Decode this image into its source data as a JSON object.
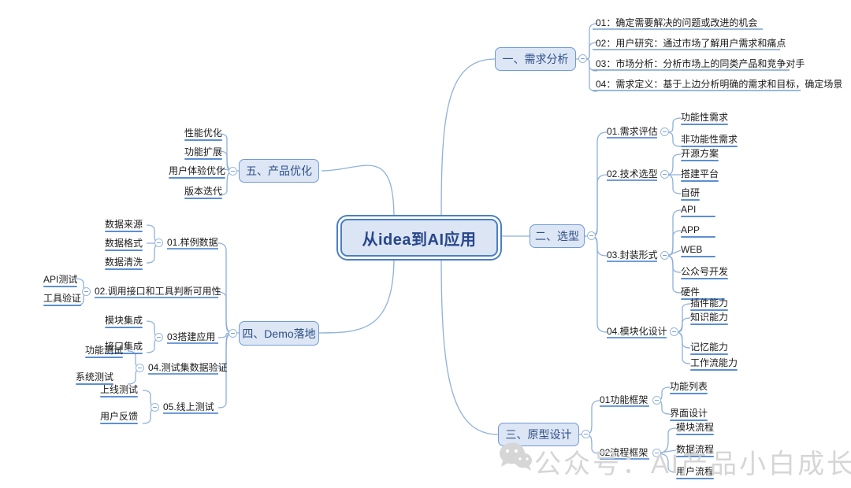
{
  "title": "从idea到AI应用 思维导图",
  "colors": {
    "node_fill": "#dce6f5",
    "node_border": "#6f9ad4",
    "root_fill": "#dbe5f3",
    "root_border": "#4a7fc4",
    "root_text": "#27468c",
    "link": "#8fb0da",
    "leaf_underline": "#5b8fd4",
    "watermark": "#d6d6d6"
  },
  "root": {
    "label": "从idea到AI应用"
  },
  "branches": {
    "requirement": {
      "label": "一、需求分析",
      "children": [
        {
          "label": "01：确定需要解决的问题或改进的机会"
        },
        {
          "label": "02：用户研究：通过市场了解用户需求和痛点"
        },
        {
          "label": "03：市场分析：分析市场上的同类产品和竞争对手"
        },
        {
          "label": "04：需求定义：基于上边分析明确的需求和目标，确定场景"
        }
      ]
    },
    "selection": {
      "label": "二、选型",
      "children": [
        {
          "label": "01.需求评估",
          "leaves": [
            "功能性需求",
            "非功能性需求"
          ]
        },
        {
          "label": "02.技术选型",
          "leaves": [
            "开源方案",
            "搭建平台",
            "自研"
          ]
        },
        {
          "label": "03.封装形式",
          "leaves": [
            "API",
            "APP",
            "WEB",
            "公众号开发",
            "硬件"
          ]
        },
        {
          "label": "04.模块化设计",
          "leaves": [
            "插件能力",
            "知识能力",
            "记忆能力",
            "工作流能力"
          ]
        }
      ]
    },
    "prototype": {
      "label": "三、原型设计",
      "children": [
        {
          "label": "01功能框架",
          "leaves": [
            "功能列表",
            "界面设计"
          ]
        },
        {
          "label": "02流程框架",
          "leaves": [
            "模块流程",
            "数据流程",
            "用户流程"
          ]
        }
      ]
    },
    "demo": {
      "label": "四、Demo落地",
      "children": [
        {
          "label": "01.样例数据",
          "leaves": [
            "数据来源",
            "数据格式",
            "数据清洗"
          ]
        },
        {
          "label": "02.调用接口和工具判断可用性",
          "leaves": [
            "API测试",
            "工具验证"
          ]
        },
        {
          "label": "03搭建应用",
          "leaves": [
            "模块集成",
            "接口集成"
          ]
        },
        {
          "label": "04.测试集数据验证",
          "leaves": [
            "功能测试",
            "系统测试"
          ]
        },
        {
          "label": "05.线上测试",
          "leaves": [
            "上线测试",
            "用户反馈"
          ]
        }
      ]
    },
    "optimize": {
      "label": "五、产品优化",
      "leaves": [
        "性能优化",
        "功能扩展",
        "用户体验优化",
        "版本迭代"
      ]
    }
  },
  "watermark": {
    "text": "公众号：AI产品小白成长记",
    "icon": "wechat-icon"
  }
}
